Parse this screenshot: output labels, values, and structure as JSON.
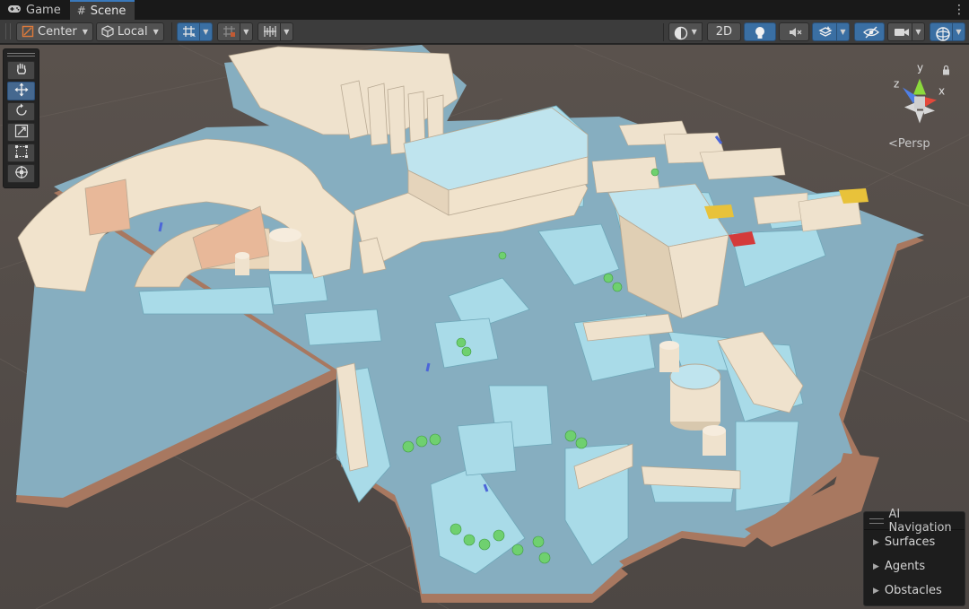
{
  "tabs": [
    {
      "label": "Game",
      "icon": "gamepad-icon",
      "active": false
    },
    {
      "label": "Scene",
      "icon": "grid-hash-icon",
      "active": true
    }
  ],
  "toolbar": {
    "pivot_mode": "Center",
    "pivot_rotation": "Local",
    "mode_2d": "2D"
  },
  "gizmo": {
    "axis_x": "x",
    "axis_y": "y",
    "axis_z": "z",
    "projection": "Persp"
  },
  "ai_navigation": {
    "title": "AI Navigation",
    "items": [
      "Surfaces",
      "Agents",
      "Obstacles"
    ]
  },
  "colors": {
    "accent_blue": "#3a6fa3",
    "navmesh": "#a9dbe8",
    "wall": "#f1e3cc",
    "floor_brown": "#a87860",
    "x_axis": "#e4483a",
    "y_axis": "#8bd93c",
    "z_axis": "#4f7fe6"
  }
}
